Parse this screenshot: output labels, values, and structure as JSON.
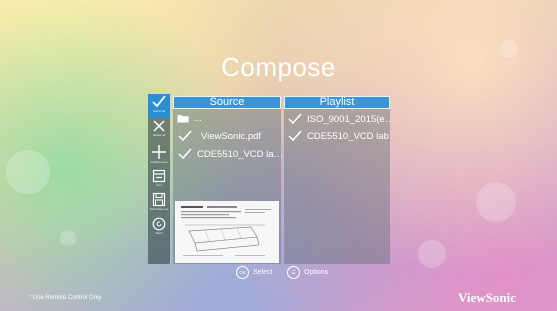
{
  "screen": {
    "title": "Compose"
  },
  "toolbar": {
    "items": [
      {
        "icon": "check-icon",
        "label": "Select all"
      },
      {
        "icon": "close-icon",
        "label": "Delete all"
      },
      {
        "icon": "plus-icon",
        "label": "Add/Remove"
      },
      {
        "icon": "sort-icon",
        "label": "Sort"
      },
      {
        "icon": "save-icon",
        "label": "Save/Save as"
      },
      {
        "icon": "back-icon",
        "label": "Back"
      }
    ]
  },
  "source": {
    "header": "Source",
    "folder_label": "...",
    "files": [
      "ViewSonic.pdf",
      "CDE5510_VCD la…"
    ]
  },
  "playlist": {
    "header": "Playlist",
    "files": [
      "ISO_9001_2015(e…",
      "CDE5510_VCD lab"
    ]
  },
  "footer": {
    "ok_key": "OK",
    "select_label": "Select",
    "options_key": "☰",
    "options_label": "Options",
    "remote_note": "* Use Remote Control Only",
    "brand": "ViewSonic"
  },
  "colors": {
    "accent": "#3a94d8",
    "panel": "#5a6e73"
  }
}
